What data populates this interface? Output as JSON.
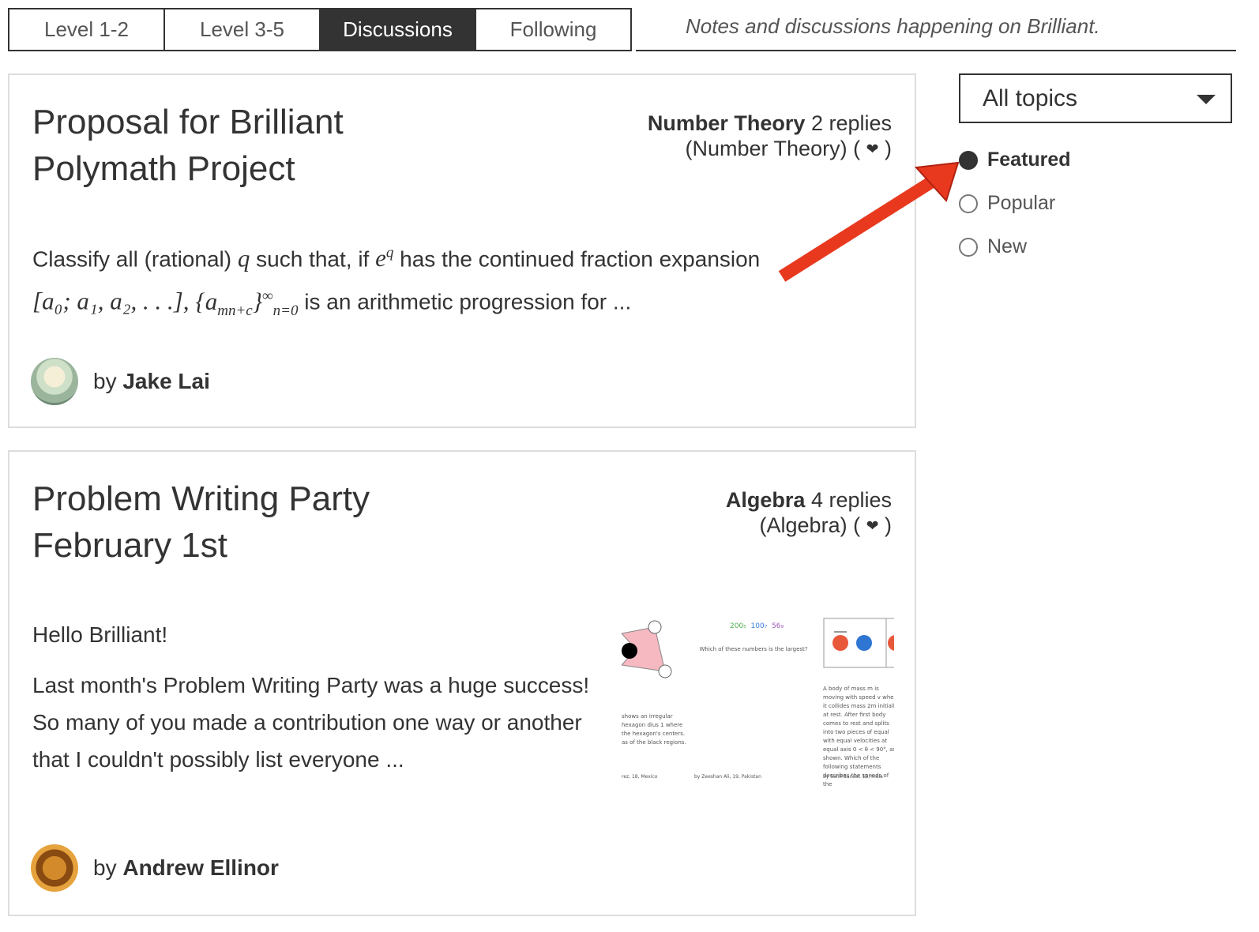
{
  "tabs": [
    {
      "label": "Level 1-2",
      "active": false
    },
    {
      "label": "Level 3-5",
      "active": false
    },
    {
      "label": "Discussions",
      "active": true
    },
    {
      "label": "Following",
      "active": false
    }
  ],
  "tagline": "Notes and discussions happening on Brilliant.",
  "filters": {
    "topic_dropdown": "All topics",
    "sort_options": [
      {
        "label": "Featured",
        "selected": true
      },
      {
        "label": "Popular",
        "selected": false
      },
      {
        "label": "New",
        "selected": false
      }
    ]
  },
  "discussions": [
    {
      "title": "Proposal for Brilliant Polymath Project",
      "topic": "Number Theory",
      "replies": "2 replies",
      "topic_paren": "(Number Theory)",
      "excerpt_line1_a": "Classify all (rational)",
      "excerpt_line1_b": "such that, if",
      "excerpt_line1_c": "has the continued fraction expansion",
      "excerpt_line2_end": "is an arithmetic progression for ...",
      "math_q": "q",
      "math_e": "e",
      "math_exp": "q",
      "math_cf": "[a₀; a₁, a₂, . . .],",
      "math_seq": "{a",
      "math_seq_sub": "mn+c",
      "math_seq_close": "}",
      "math_seq_sup": "∞",
      "math_seq_sub2": "n=0",
      "author_prefix": "by",
      "author": "Jake Lai"
    },
    {
      "title": "Problem Writing Party February 1st",
      "topic": "Algebra",
      "replies": "4 replies",
      "topic_paren": "(Algebra)",
      "greeting": "Hello Brilliant!",
      "excerpt": "Last month's Problem Writing Party was a huge success! So many of you made a contribution one way or another that I couldn't possibly list everyone ...",
      "author_prefix": "by",
      "author": "Andrew Ellinor",
      "thumbnail": {
        "numbers": [
          "200₅",
          "100₇",
          "56₉"
        ],
        "question": "Which of these numbers is the largest?",
        "left_text": "shows an irregular hexagon dius 1 where the hexagon's centers. as of the black regions.",
        "left_foot": "rez, 18, Mexico",
        "mid_foot": "by Zeeshan Ali, 19, Pakistan",
        "right_text": "A body of mass m is moving with speed v when it collides mass 2m initially at rest. After first body comes to rest and splits into two pieces of equal with equal velocities at equal axis 0 < θ < 90°, as shown. Which of the following statements describes the speeds of the",
        "right_foot": "by Sahil Bansal, 16, India"
      }
    }
  ]
}
